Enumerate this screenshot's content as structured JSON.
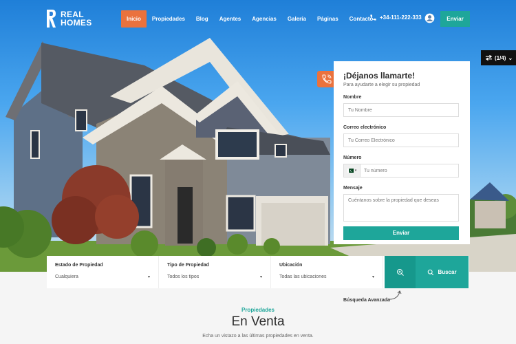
{
  "brand": {
    "line1": "REAL",
    "line2": "HOMES"
  },
  "nav": {
    "items": [
      {
        "label": "Inicio",
        "active": true
      },
      {
        "label": "Propiedades",
        "active": false
      },
      {
        "label": "Blog",
        "active": false
      },
      {
        "label": "Agentes",
        "active": false
      },
      {
        "label": "Agencias",
        "active": false
      },
      {
        "label": "Galería",
        "active": false
      },
      {
        "label": "Páginas",
        "active": false
      },
      {
        "label": "Contacto",
        "active": false
      }
    ],
    "phone": "+34-111-222-333",
    "submit_label": "Enviar"
  },
  "slider": {
    "counter": "(1/4)"
  },
  "callback_form": {
    "title": "¡Déjanos llamarte!",
    "subtitle": "Para ayudarte a elegir su propiedad",
    "name_label": "Nombre",
    "name_placeholder": "Tu Nombre",
    "email_label": "Correo electrónico",
    "email_placeholder": "Tu Correo Electrónico",
    "number_label": "Número",
    "number_placeholder": "Tu número",
    "message_label": "Mensaje",
    "message_placeholder": "Cuéntanos sobre la propiedad que deseas",
    "submit_label": "Enviar"
  },
  "search": {
    "fields": [
      {
        "label": "Estado de Propiedad",
        "value": "Cualquiera"
      },
      {
        "label": "Tipo de Propiedad",
        "value": "Todos los tipos"
      },
      {
        "label": "Ubicación",
        "value": "Todas las ubicaciones"
      }
    ],
    "search_label": "Buscar",
    "advanced_label": "Búsqueda Avanzada"
  },
  "section": {
    "kicker": "Propiedades",
    "title": "En Venta",
    "subtitle": "Echa un vistazo a las últimas propiedades en venta."
  },
  "colors": {
    "accent": "#1ea69a",
    "active_nav": "#ea723d"
  }
}
